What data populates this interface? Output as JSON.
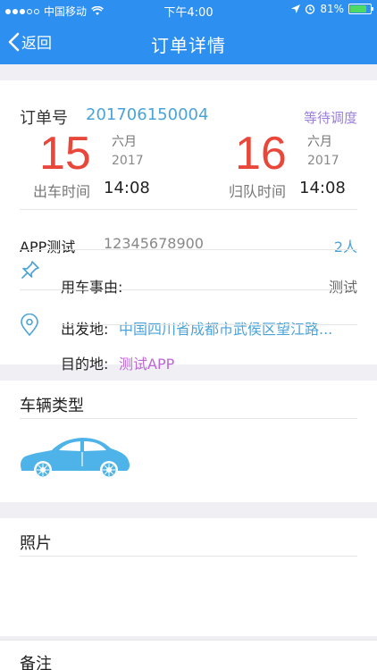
{
  "status_bar": {
    "carrier": "中国移动",
    "time": "下午4:00",
    "battery": "81%",
    "battery_level": 0.81,
    "icons": [
      "signal-dots",
      "wifi-icon",
      "location-arrow-icon",
      "alarm-icon",
      "battery-icon"
    ]
  },
  "nav": {
    "back_label": "返回",
    "title": "订单详情"
  },
  "order": {
    "no_label": "订单号",
    "no": "201706150004",
    "status": "等待调度",
    "departure": {
      "day": "15",
      "month": "六月",
      "year": "2017",
      "label": "出车时间",
      "time": "14:08"
    },
    "return": {
      "day": "16",
      "month": "六月",
      "year": "2017",
      "label": "归队时间",
      "time": "14:08"
    },
    "contact_name": "APP测试",
    "contact_phone": "12345678900",
    "people": "2人",
    "reason_label": "用车事由:",
    "reason": "测试",
    "from_label": "出发地:",
    "from": "中国四川省成都市武侯区望江路...",
    "to_label": "目的地:",
    "to": "测试APP"
  },
  "sections": {
    "vehicle_type": "车辆类型",
    "photos": "照片",
    "notes": "备注"
  },
  "colors": {
    "primary": "#2d8ff0",
    "date_red": "#e8473a",
    "link_blue": "#4aa3d8",
    "status_purple": "#9b7fd9",
    "car_blue": "#4db3e8"
  }
}
